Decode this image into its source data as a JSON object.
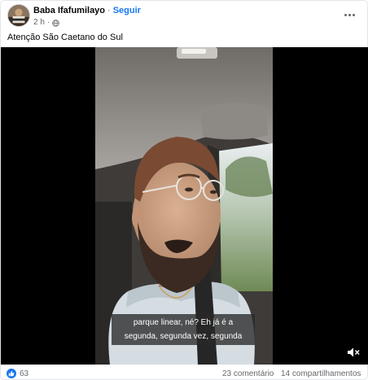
{
  "post": {
    "author": "Baba Ifafumilayo",
    "separator": "·",
    "follow_label": "Seguir",
    "time": "2 h",
    "audience_icon": "globe-icon",
    "menu_icon": "more-options-icon",
    "caption": "Atenção São Caetano do Sul"
  },
  "video": {
    "subtitle_line1": "parque linear, né? Eh já é a",
    "subtitle_line2": "segunda, segunda vez, segunda",
    "volume_icon": "speaker-muted-icon"
  },
  "stats": {
    "reaction_icon": "like-icon",
    "reaction_count": "63",
    "comments": "23 comentário",
    "shares": "14 compartilhamentos"
  },
  "colors": {
    "link": "#1877f2",
    "secondary_text": "#65676b",
    "like_badge": "#1877f2"
  }
}
